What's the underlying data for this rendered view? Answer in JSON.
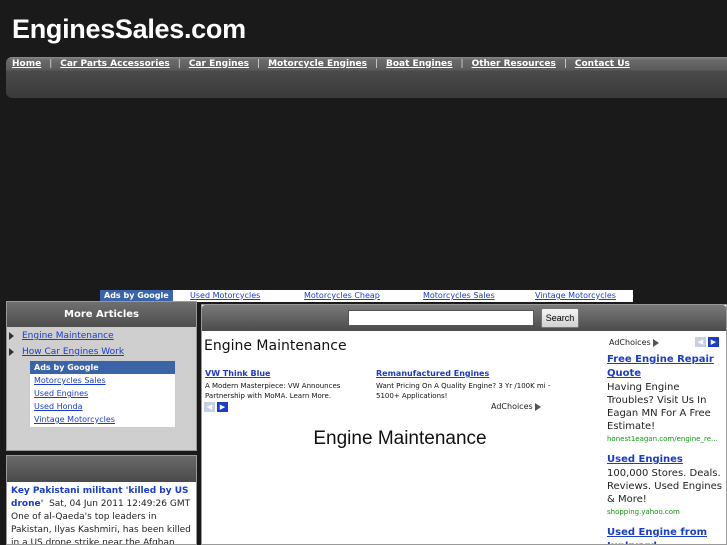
{
  "site": {
    "title": "EnginesSales.com"
  },
  "nav": [
    "Home",
    "Car Parts Accessories",
    "Car Engines",
    "Motorcycle Engines",
    "Boat Engines",
    "Other Resources",
    "Contact Us"
  ],
  "nav_separator": "|",
  "top_ads": {
    "label": "Ads by Google",
    "links": [
      "Used Motorcycles",
      "Motorcycles Cheap",
      "Motorcycles Sales",
      "Vintage Motorcycles"
    ]
  },
  "sidebar": {
    "heading": "More Articles",
    "items": [
      "Engine Maintenance",
      "How Car Engines Work"
    ],
    "ads_label": "Ads by Google",
    "ads": [
      "Motorcycles Sales",
      "Used Engines",
      "Used Honda",
      "Vintage Motorcycles"
    ]
  },
  "news": {
    "title": "Key Pakistani militant 'killed by US drone'",
    "date": "Sat, 04 Jun 2011 12:49:26 GMT",
    "body": "One of al-Qaeda's top leaders in Pakistan, Ilyas Kashmiri, has been killed in a US drone strike near the Afghan border, locals"
  },
  "search": {
    "value": "",
    "button_label": "Search"
  },
  "main": {
    "page_heading": "Engine Maintenance",
    "article_heading": "Engine Maintenance",
    "adchoices": "AdChoices",
    "inline_ads": [
      {
        "title": "VW Think Blue",
        "desc": "A Modern Masterpiece: VW Announces Partnership with MoMA. Learn More."
      },
      {
        "title": "Remanufactured Engines",
        "desc": "Want Pricing On A Quality Engine? 3 Yr /100K mi - 5100+ Applications!"
      }
    ],
    "right_ads": [
      {
        "title": "Free Engine Repair Quote",
        "desc": "Having Engine Troubles? Visit Us In Eagan MN For A Free Estimate!",
        "url": "honest1eagan.com/engine_re..."
      },
      {
        "title": "Used Engines",
        "desc": "100,000 Stores. Deals. Reviews. Used Engines & More!",
        "url": "shopping.yahoo.com"
      },
      {
        "title": "Used Engine from Junkyard",
        "desc": "",
        "url": ""
      }
    ]
  }
}
